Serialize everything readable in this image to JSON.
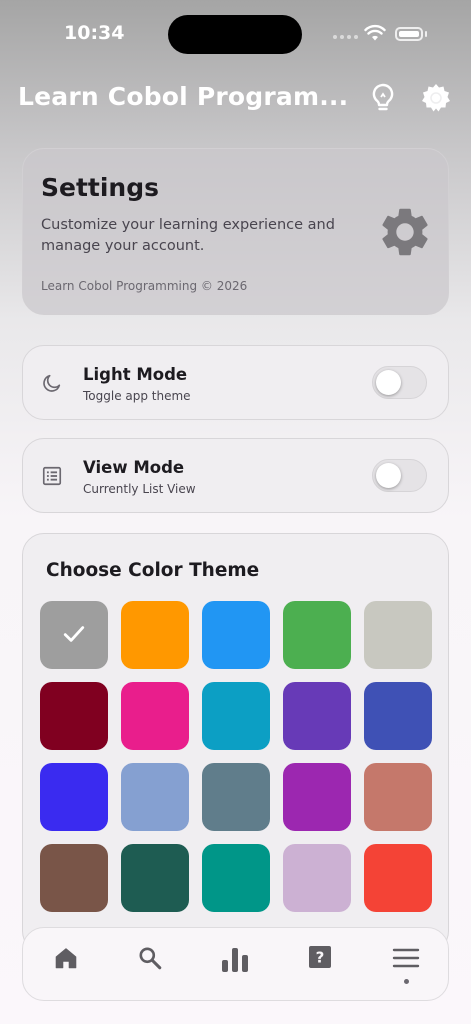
{
  "status": {
    "time": "10:34"
  },
  "appbar": {
    "title": "Learn Cobol Program...",
    "icons": [
      "lightbulb-icon",
      "gear-icon"
    ]
  },
  "hero": {
    "title": "Settings",
    "description": "Customize your learning experience and manage your account.",
    "copyright": "Learn Cobol Programming © 2026"
  },
  "settings": [
    {
      "title": "Light Mode",
      "subtitle": "Toggle app theme",
      "icon": "moon-icon",
      "enabled": false
    },
    {
      "title": "View Mode",
      "subtitle": "Currently List View",
      "icon": "list-icon",
      "enabled": false
    }
  ],
  "theme": {
    "title": "Choose Color Theme",
    "selected_index": 0,
    "colors": [
      "#9e9e9e",
      "#ff9800",
      "#2196f3",
      "#4caf50",
      "#c8c8c0",
      "#800020",
      "#e91e8c",
      "#0c9fc4",
      "#673ab7",
      "#3f51b5",
      "#3a2bf0",
      "#85a0d1",
      "#607d8b",
      "#9c27b0",
      "#c5786b",
      "#795548",
      "#1e5c52",
      "#009688",
      "#ccb1d3",
      "#f44336"
    ]
  },
  "nav": {
    "items": [
      "home-icon",
      "search-icon",
      "stats-icon",
      "help-icon",
      "menu-icon"
    ],
    "active_index": 4
  }
}
